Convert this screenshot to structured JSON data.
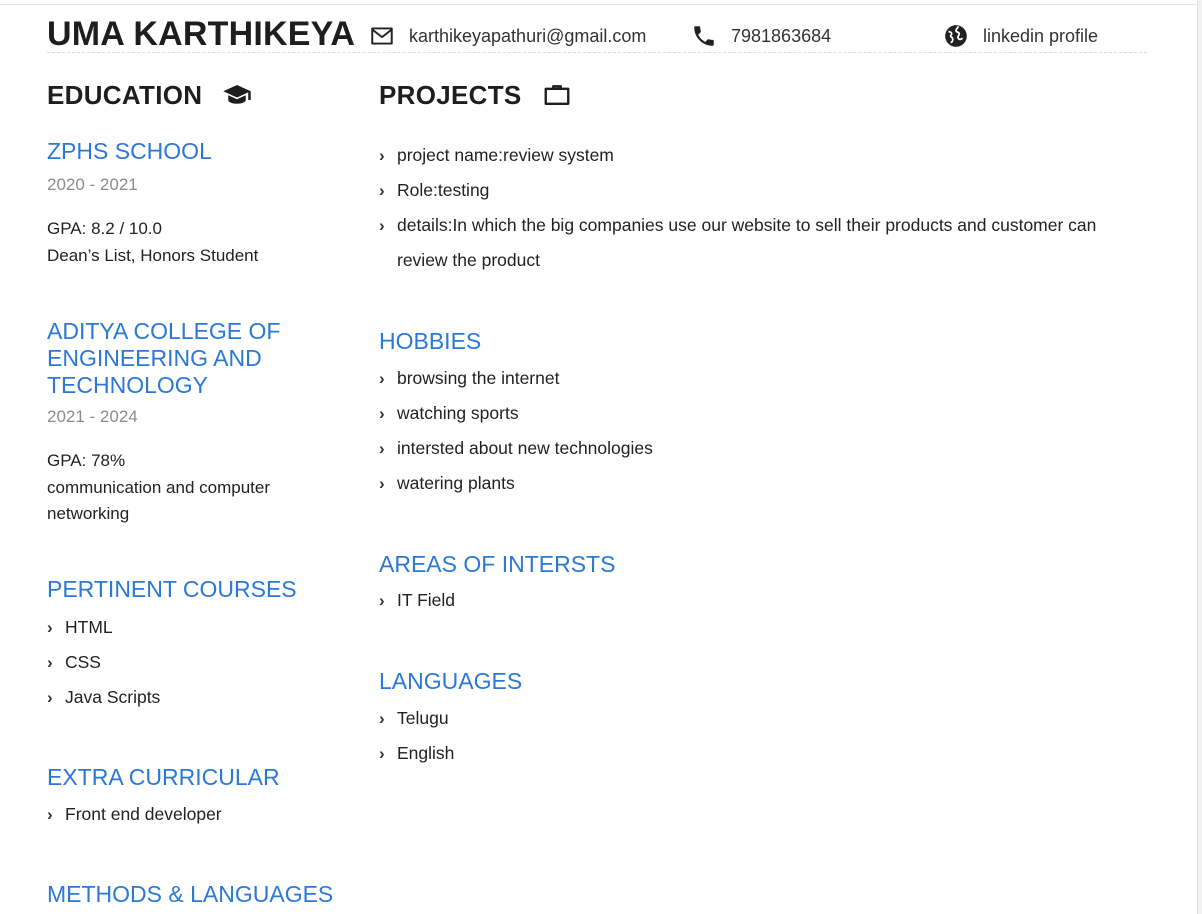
{
  "header": {
    "name": "UMA KARTHIKEYA",
    "email": "karthikeyapathuri@gmail.com",
    "phone": "7981863684",
    "linkedin": "linkedin profile"
  },
  "education": {
    "title": "EDUCATION",
    "schools": [
      {
        "name": "ZPHS SCHOOL",
        "years": "2020 - 2021",
        "gpa": "GPA: 8.2 / 10.0",
        "note": "Dean’s List, Honors Student"
      },
      {
        "name": "ADITYA COLLEGE OF ENGINEERING AND TECHNOLOGY",
        "years": "2021 - 2024",
        "gpa": "GPA: 78%",
        "note": "communication and computer networking"
      }
    ]
  },
  "courses": {
    "title": "PERTINENT COURSES",
    "items": [
      "HTML",
      "CSS",
      "Java Scripts"
    ]
  },
  "extra": {
    "title": "EXTRA CURRICULAR",
    "items": [
      "Front end developer"
    ]
  },
  "methods": {
    "title": "METHODS & LANGUAGES"
  },
  "projects": {
    "title": "PROJECTS",
    "items": [
      "project name:review system",
      "Role:testing",
      "details:In which the big companies use our website to sell their products and customer can review the product"
    ]
  },
  "hobbies": {
    "title": "HOBBIES",
    "items": [
      "browsing the internet",
      "watching sports",
      "intersted about new technologies",
      "watering plants"
    ]
  },
  "interests": {
    "title": "AREAS OF INTERSTS",
    "items": [
      "IT Field"
    ]
  },
  "languages": {
    "title": "LANGUAGES",
    "items": [
      "Telugu",
      "English"
    ]
  },
  "icons": {
    "email": "envelope-icon",
    "phone": "phone-icon",
    "linkedin": "globe-icon",
    "education": "graduation-cap-icon",
    "projects": "briefcase-icon",
    "bullet": "chevron-right-icon"
  },
  "colors": {
    "accent": "#2b78d6",
    "text": "#222222",
    "muted": "#8c8c8c"
  }
}
